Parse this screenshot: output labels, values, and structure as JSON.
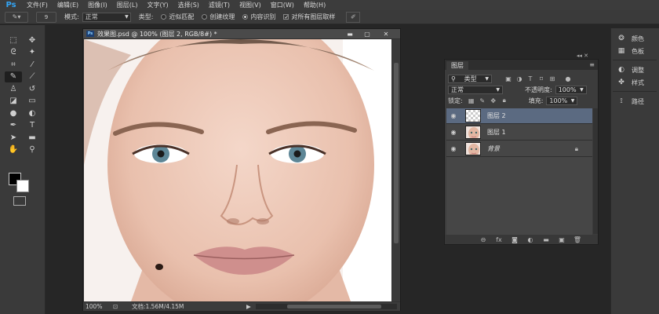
{
  "app": {
    "logo": "Ps"
  },
  "menu": [
    "文件(F)",
    "编辑(E)",
    "图像(I)",
    "图层(L)",
    "文字(Y)",
    "选择(S)",
    "滤镜(T)",
    "视图(V)",
    "窗口(W)",
    "帮助(H)"
  ],
  "options": {
    "tool_icon": "spot-healing-brush-icon",
    "brush_size": "9",
    "mode_label": "模式:",
    "mode_value": "正常",
    "type_label": "类型:",
    "type_options": [
      {
        "label": "近似匹配",
        "selected": false
      },
      {
        "label": "创建纹理",
        "selected": false
      },
      {
        "label": "内容识别",
        "selected": true
      }
    ],
    "sample_all_label": "对所有图层取样",
    "sample_all_checked": true
  },
  "document": {
    "title": "效果图.psd @ 100% (图层 2, RGB/8#) *",
    "icon_text": "Ps",
    "zoom": "100%",
    "doc_info": "文档:1.56M/4.15M"
  },
  "layers_panel": {
    "tab_label": "图层",
    "filter_label": "类型",
    "blend_mode": "正常",
    "opacity_label": "不透明度:",
    "opacity_value": "100%",
    "lock_label": "锁定:",
    "fill_label": "填充:",
    "fill_value": "100%",
    "layers": [
      {
        "name": "图层 2",
        "selected": true,
        "transparent_thumb": true,
        "locked": false,
        "italic": false
      },
      {
        "name": "图层 1",
        "selected": false,
        "transparent_thumb": false,
        "locked": false,
        "italic": false
      },
      {
        "name": "背景",
        "selected": false,
        "transparent_thumb": false,
        "locked": true,
        "italic": true
      }
    ]
  },
  "right_dock": [
    {
      "label": "颜色",
      "icon": "color-wheel-icon"
    },
    {
      "label": "色板",
      "icon": "swatches-icon"
    },
    {
      "label": "调整",
      "icon": "adjustments-icon"
    },
    {
      "label": "样式",
      "icon": "styles-icon"
    },
    {
      "label": "路径",
      "icon": "paths-icon"
    }
  ],
  "colors": {
    "foreground": "#000000",
    "background": "#ffffff",
    "selected_layer": "#5b6a81",
    "accent": "#33a5f5"
  }
}
